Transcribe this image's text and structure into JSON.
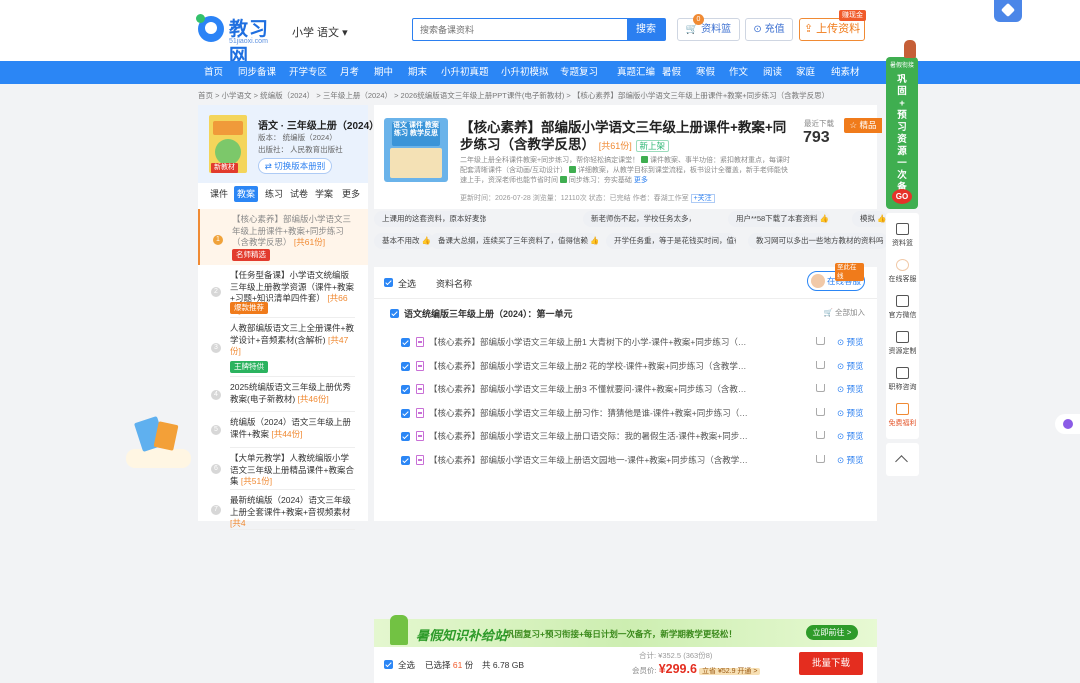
{
  "header": {
    "logo_name": "教习网",
    "logo_url": "51jiaoxi.com",
    "grade_selector": "小学 语文",
    "search_placeholder": "搜索备课资料",
    "search_button": "搜索",
    "basket_label": "资料篮",
    "basket_count": "0",
    "recharge_label": "充值",
    "upload_label": "上传资料",
    "upload_tag": "赚现金"
  },
  "nav": [
    "首页",
    "同步备课",
    "开学专区",
    "月考",
    "期中",
    "期末",
    "小升初真题",
    "小升初模拟",
    "专题复习",
    "真题汇编",
    "暑假",
    "寒假",
    "作文",
    "阅读",
    "家庭",
    "纯素材"
  ],
  "breadcrumb": "首页 > 小学语文 > 统编版（2024） > 三年级上册（2024） > 2026统编版语文三年级上册PPT课件(电子新教材) > 【核心素养】部编版小学语文三年级上册课件+教案+同步练习（含教学反思）",
  "book": {
    "title": "语文 · 三年级上册（2024）",
    "edition": "版本：  统编版（2024）",
    "publisher": "出版社：  人民教育出版社",
    "switch": "切换版本册别",
    "new_tag": "新教材"
  },
  "left_tabs": [
    "课件",
    "教案",
    "练习",
    "试卷",
    "学案",
    "更多"
  ],
  "left_items": [
    {
      "num": "1",
      "text": "【核心素养】部编版小学语文三年级上册课件+教案+同步练习（含教学反思）",
      "count": "[共61份]",
      "badge": "名师精选",
      "badge_color": "#e23b2d"
    },
    {
      "num": "2",
      "text": "【任务型备课】小学语文统编版三年级上册教学资源（课件+教案+习题+知识清单四件套）",
      "count": "[共66份]",
      "badge": "爆款推荐",
      "badge_color": "#f07b1b"
    },
    {
      "num": "3",
      "text": "人教部编版语文三上全册课件+教学设计+音频素材(含解析)",
      "count": "[共47份]",
      "badge": "王牌特供",
      "badge_color": "#2bb35f"
    },
    {
      "num": "4",
      "text": "2025统编版语文三年级上册优秀教案(电子新教材)",
      "count": "[共46份]",
      "badge": "",
      "badge_color": ""
    },
    {
      "num": "5",
      "text": "统编版（2024）语文三年级上册 课件+教案",
      "count": "[共44份]",
      "badge": "",
      "badge_color": ""
    },
    {
      "num": "6",
      "text": "【大单元教学】人教统编版小学语文三年级上册精品课件+教案合集",
      "count": "[共51份]",
      "badge": "",
      "badge_color": ""
    },
    {
      "num": "7",
      "text": "最新统编版（2024）语文三年级上册全套课件+教案+音视频素材",
      "count": "[共4",
      "badge": "",
      "badge_color": ""
    }
  ],
  "product": {
    "cover_text": "语文 课件 教案 练习 教学反思",
    "title": "【核心素养】部编版小学语文三年级上册课件+教案+同步练习（含教学反思）",
    "count": "[共61份]",
    "new_tag": "新上架",
    "desc_1": "二年级上册全科课件教案+同步练习，帮你轻松搞定课堂！",
    "check_1": "课件教案、事半功倍：紧扣教材重点，每课时配套清晰课件（含动画/互动设计）",
    "check_2": "详细教案，从教学目标到课堂流程，板书设计全覆盖，新手老师能快速上手，资深老师也能节省时间",
    "check_3": "同步练习：夯实基础",
    "more": "更多",
    "meta": "更新时间：2026-07-28   浏览量：12110次   状态：已完结   作者：春湖工作室",
    "follow": "+关注",
    "dl_label": "最近下载",
    "dl_count": "793",
    "featured": "精品"
  },
  "comments": [
    "上课用的这套资料，原本好麦张，还好这套资料编排很合理。",
    "新老师伤不起，学校任务太多，真的没时间啊。",
    "用户**58下载了本套资料",
    "模拟",
    "基本不用改",
    "备课大总纲，连续买了三年资料了，值得信赖",
    "开学任务重，等于是花钱买时间，值得",
    "教习网可以多出一些地方教材的资料吗"
  ],
  "files": {
    "select_all": "全选",
    "col_name": "资料名称",
    "service": "在线客服",
    "service_tag": "至此在线",
    "unit": "语文统编版三年级上册（2024）：第一单元",
    "unit_action": "全部加入",
    "rows": [
      "【核心素养】部编版小学语文三年级上册1 大青树下的小学-课件+教案+同步练习（含教学反思）",
      "【核心素养】部编版小学语文三年级上册2 花的学校-课件+教案+同步练习（含教学反思）",
      "【核心素养】部编版小学语文三年级上册3 不懂就要问-课件+教案+同步练习（含教学反思）",
      "【核心素养】部编版小学语文三年级上册习作：猜猜他是谁-课件+教案+同步练习（含教学反思）",
      "【核心素养】部编版小学语文三年级上册口语交际：我的暑假生活-课件+教案+同步练习（含教学反思）",
      "【核心素养】部编版小学语文三年级上册语文园地一-课件+教案+同步练习（含教学反思）"
    ],
    "preview": "预览"
  },
  "banner": {
    "title": "暑假知识补给站",
    "text": "巩固复习+预习衔接+每日计划一次备齐，新学期教学更轻松！",
    "go": "立即前往 >"
  },
  "buy": {
    "select_all": "全选",
    "selected": "已选择",
    "selected_n": "61",
    "selected_unit": "份",
    "size": "共 6.78 GB",
    "total": "合计: ¥352.5  (363份8)",
    "member": "会员价:",
    "price": "¥299.6",
    "save": "立省 ¥52.9  开通 >",
    "batch": "批量下载"
  },
  "green_banner": {
    "header": "暑假衔接",
    "text": "巩固+预习资源一次备齐",
    "go": "GO"
  },
  "right_side": [
    {
      "label": "资料篮",
      "icon": "cart-icon"
    },
    {
      "label": "在线客服",
      "icon": "service-avatar-icon"
    },
    {
      "label": "官方微信",
      "icon": "wechat-icon"
    },
    {
      "label": "资源定制",
      "icon": "edit-icon"
    },
    {
      "label": "职称咨询",
      "icon": "graduation-cap-icon"
    },
    {
      "label": "免费福利",
      "icon": "gift-icon"
    }
  ]
}
